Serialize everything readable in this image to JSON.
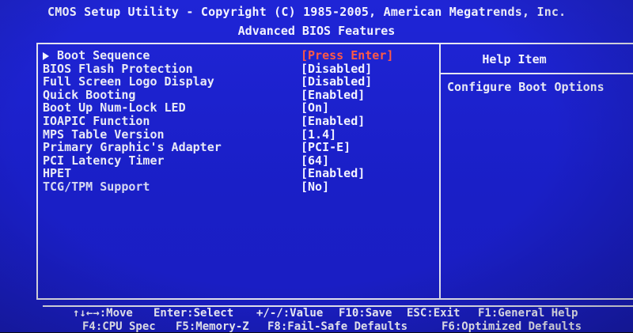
{
  "header": {
    "title": "CMOS Setup Utility - Copyright (C) 1985-2005, American Megatrends, Inc.",
    "subtitle": "Advanced BIOS Features"
  },
  "menu": {
    "items": [
      {
        "label": "Boot Sequence",
        "value": "[Press Enter]",
        "submenu": true,
        "selected": true
      },
      {
        "label": "BIOS Flash Protection",
        "value": "[Disabled]"
      },
      {
        "label": "Full Screen Logo Display",
        "value": "[Disabled]"
      },
      {
        "label": "Quick Booting",
        "value": "[Enabled]"
      },
      {
        "label": "Boot Up Num-Lock LED",
        "value": "[On]"
      },
      {
        "label": "IOAPIC Function",
        "value": "[Enabled]"
      },
      {
        "label": "MPS Table Version",
        "value": "[1.4]"
      },
      {
        "label": "Primary Graphic's Adapter",
        "value": "[PCI-E]"
      },
      {
        "label": "PCI Latency Timer",
        "value": "[64]"
      },
      {
        "label": "HPET",
        "value": "[Enabled]"
      },
      {
        "label": "TCG/TPM Support",
        "value": "[No]"
      }
    ]
  },
  "help": {
    "title": "Help Item",
    "text": "Configure Boot Options"
  },
  "footer": {
    "move": "↑↓←→:Move",
    "enter": "Enter:Select",
    "value": "+/-/:Value",
    "f10": "F10:Save",
    "esc": "ESC:Exit",
    "f1": "F1:General Help",
    "f4": "F4:CPU Spec",
    "f5": "F5:Memory-Z",
    "f8": "F8:Fail-Safe Defaults",
    "f6": "F6:Optimized Defaults"
  },
  "colors": {
    "background": "#1f25d6",
    "text": "#f3f3ff",
    "highlight": "#ff5a45"
  }
}
